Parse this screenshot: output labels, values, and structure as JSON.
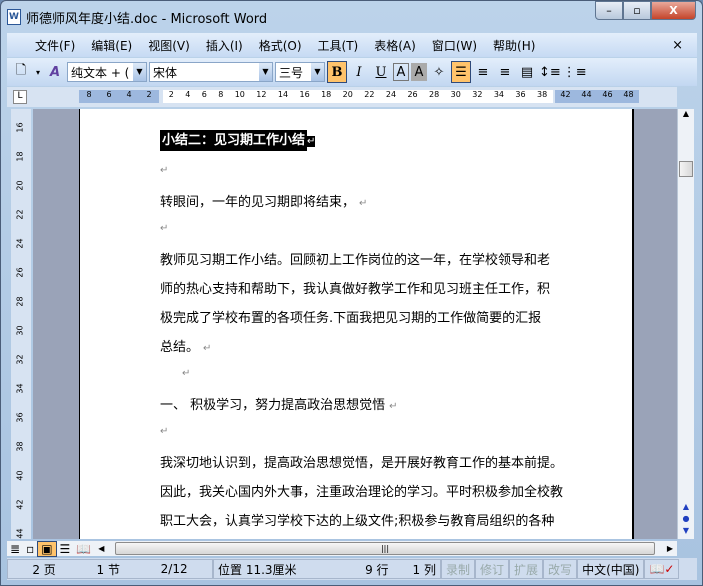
{
  "window": {
    "title": "师德师风年度小结.doc - Microsoft Word",
    "minimize": "–",
    "restore": "▫",
    "close": "X"
  },
  "menu": [
    "文件(F)",
    "编辑(E)",
    "视图(V)",
    "插入(I)",
    "格式(O)",
    "工具(T)",
    "表格(A)",
    "窗口(W)",
    "帮助(H)"
  ],
  "menu_close": "×",
  "toolbar": {
    "style": "纯文本 + (",
    "font": "宋体",
    "size": "三号",
    "bold": "B",
    "italic": "I",
    "underline": "U",
    "char_border": "A",
    "char_shading": "A"
  },
  "ruler": {
    "left": [
      "8",
      "6",
      "4",
      "2"
    ],
    "main": [
      "2",
      "4",
      "6",
      "8",
      "10",
      "12",
      "14",
      "16",
      "18",
      "20",
      "22",
      "24",
      "26",
      "28",
      "30",
      "32",
      "34",
      "36",
      "38"
    ],
    "right": [
      "42",
      "44",
      "46",
      "48"
    ]
  },
  "vruler": [
    "16",
    "18",
    "20",
    "22",
    "24",
    "26",
    "28",
    "30",
    "32",
    "34",
    "36",
    "38",
    "40",
    "42",
    "44"
  ],
  "document": {
    "heading": "小结二：见习期工作小结",
    "mark": "↵",
    "lines": [
      "转眼间，一年的见习期即将结束，",
      "教师见习期工作小结。回顾初上工作岗位的这一年，在学校领导和老",
      "师的热心支持和帮助下，我认真做好教学工作和见习班主任工作，积",
      "极完成了学校布置的各项任务.下面我把见习期的工作做简要的汇报",
      "总结。",
      "一、 积极学习，努力提高政治思想觉悟",
      "我深切地认识到，提高政治思想觉悟，是开展好教育工作的基本前提。",
      "因此，我关心国内外大事，注重政治理论的学习。平时积极参加全校教",
      "职工大会，认真学习学校下达的上级文件;积极参与教育局组织的各种"
    ]
  },
  "status": {
    "page": "2 页",
    "section": "1 节",
    "pages": "2/12",
    "position": "位置 11.3厘米",
    "line": "9 行",
    "col": "1 列",
    "rec": "录制",
    "trk": "修订",
    "ext": "扩展",
    "ovr": "改写",
    "lang": "中文(中国)"
  }
}
